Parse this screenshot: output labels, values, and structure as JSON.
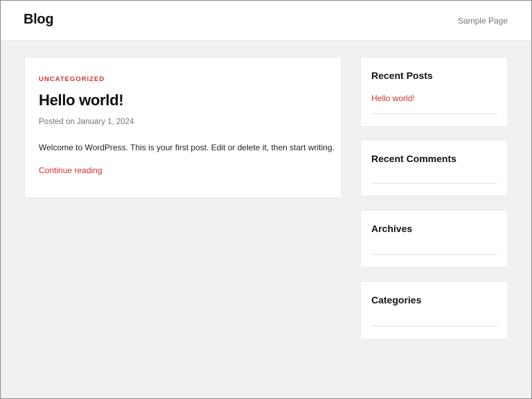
{
  "header": {
    "site_title": "Blog",
    "nav": [
      "Sample Page"
    ]
  },
  "post": {
    "category": "UNCATEGORIZED",
    "title": "Hello world!",
    "meta": "Posted on January 1, 2024",
    "excerpt": "Welcome to WordPress. This is your first post. Edit or delete it, then start writing.",
    "read_more": "Continue reading"
  },
  "sidebar": {
    "widgets": [
      {
        "title": "Recent Posts",
        "items": [
          "Hello world!"
        ]
      },
      {
        "title": "Recent Comments",
        "items": []
      },
      {
        "title": "Archives",
        "items": []
      },
      {
        "title": "Categories",
        "items": []
      }
    ]
  },
  "colors": {
    "accent": "#d32f2f",
    "background": "#f1f1f1",
    "card": "#ffffff",
    "muted_text": "#767676"
  }
}
